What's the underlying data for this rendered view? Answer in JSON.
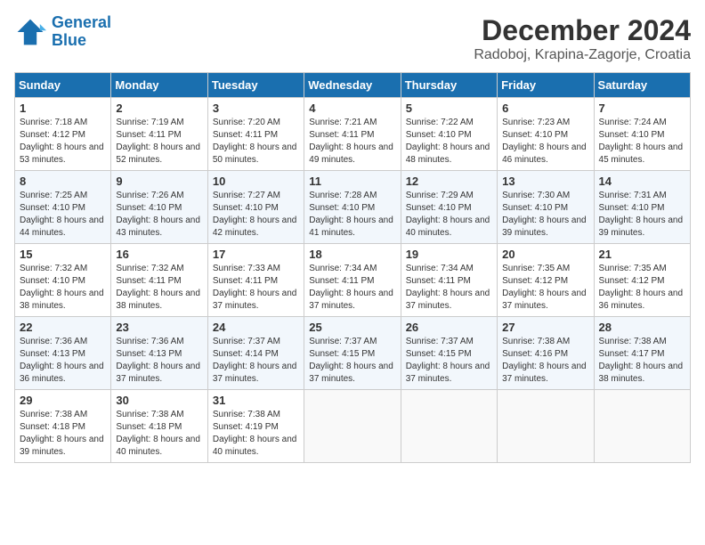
{
  "header": {
    "logo_line1": "General",
    "logo_line2": "Blue",
    "month": "December 2024",
    "location": "Radoboj, Krapina-Zagorje, Croatia"
  },
  "weekdays": [
    "Sunday",
    "Monday",
    "Tuesday",
    "Wednesday",
    "Thursday",
    "Friday",
    "Saturday"
  ],
  "weeks": [
    [
      {
        "day": "1",
        "sunrise": "Sunrise: 7:18 AM",
        "sunset": "Sunset: 4:12 PM",
        "daylight": "Daylight: 8 hours and 53 minutes."
      },
      {
        "day": "2",
        "sunrise": "Sunrise: 7:19 AM",
        "sunset": "Sunset: 4:11 PM",
        "daylight": "Daylight: 8 hours and 52 minutes."
      },
      {
        "day": "3",
        "sunrise": "Sunrise: 7:20 AM",
        "sunset": "Sunset: 4:11 PM",
        "daylight": "Daylight: 8 hours and 50 minutes."
      },
      {
        "day": "4",
        "sunrise": "Sunrise: 7:21 AM",
        "sunset": "Sunset: 4:11 PM",
        "daylight": "Daylight: 8 hours and 49 minutes."
      },
      {
        "day": "5",
        "sunrise": "Sunrise: 7:22 AM",
        "sunset": "Sunset: 4:10 PM",
        "daylight": "Daylight: 8 hours and 48 minutes."
      },
      {
        "day": "6",
        "sunrise": "Sunrise: 7:23 AM",
        "sunset": "Sunset: 4:10 PM",
        "daylight": "Daylight: 8 hours and 46 minutes."
      },
      {
        "day": "7",
        "sunrise": "Sunrise: 7:24 AM",
        "sunset": "Sunset: 4:10 PM",
        "daylight": "Daylight: 8 hours and 45 minutes."
      }
    ],
    [
      {
        "day": "8",
        "sunrise": "Sunrise: 7:25 AM",
        "sunset": "Sunset: 4:10 PM",
        "daylight": "Daylight: 8 hours and 44 minutes."
      },
      {
        "day": "9",
        "sunrise": "Sunrise: 7:26 AM",
        "sunset": "Sunset: 4:10 PM",
        "daylight": "Daylight: 8 hours and 43 minutes."
      },
      {
        "day": "10",
        "sunrise": "Sunrise: 7:27 AM",
        "sunset": "Sunset: 4:10 PM",
        "daylight": "Daylight: 8 hours and 42 minutes."
      },
      {
        "day": "11",
        "sunrise": "Sunrise: 7:28 AM",
        "sunset": "Sunset: 4:10 PM",
        "daylight": "Daylight: 8 hours and 41 minutes."
      },
      {
        "day": "12",
        "sunrise": "Sunrise: 7:29 AM",
        "sunset": "Sunset: 4:10 PM",
        "daylight": "Daylight: 8 hours and 40 minutes."
      },
      {
        "day": "13",
        "sunrise": "Sunrise: 7:30 AM",
        "sunset": "Sunset: 4:10 PM",
        "daylight": "Daylight: 8 hours and 39 minutes."
      },
      {
        "day": "14",
        "sunrise": "Sunrise: 7:31 AM",
        "sunset": "Sunset: 4:10 PM",
        "daylight": "Daylight: 8 hours and 39 minutes."
      }
    ],
    [
      {
        "day": "15",
        "sunrise": "Sunrise: 7:32 AM",
        "sunset": "Sunset: 4:10 PM",
        "daylight": "Daylight: 8 hours and 38 minutes."
      },
      {
        "day": "16",
        "sunrise": "Sunrise: 7:32 AM",
        "sunset": "Sunset: 4:11 PM",
        "daylight": "Daylight: 8 hours and 38 minutes."
      },
      {
        "day": "17",
        "sunrise": "Sunrise: 7:33 AM",
        "sunset": "Sunset: 4:11 PM",
        "daylight": "Daylight: 8 hours and 37 minutes."
      },
      {
        "day": "18",
        "sunrise": "Sunrise: 7:34 AM",
        "sunset": "Sunset: 4:11 PM",
        "daylight": "Daylight: 8 hours and 37 minutes."
      },
      {
        "day": "19",
        "sunrise": "Sunrise: 7:34 AM",
        "sunset": "Sunset: 4:11 PM",
        "daylight": "Daylight: 8 hours and 37 minutes."
      },
      {
        "day": "20",
        "sunrise": "Sunrise: 7:35 AM",
        "sunset": "Sunset: 4:12 PM",
        "daylight": "Daylight: 8 hours and 37 minutes."
      },
      {
        "day": "21",
        "sunrise": "Sunrise: 7:35 AM",
        "sunset": "Sunset: 4:12 PM",
        "daylight": "Daylight: 8 hours and 36 minutes."
      }
    ],
    [
      {
        "day": "22",
        "sunrise": "Sunrise: 7:36 AM",
        "sunset": "Sunset: 4:13 PM",
        "daylight": "Daylight: 8 hours and 36 minutes."
      },
      {
        "day": "23",
        "sunrise": "Sunrise: 7:36 AM",
        "sunset": "Sunset: 4:13 PM",
        "daylight": "Daylight: 8 hours and 37 minutes."
      },
      {
        "day": "24",
        "sunrise": "Sunrise: 7:37 AM",
        "sunset": "Sunset: 4:14 PM",
        "daylight": "Daylight: 8 hours and 37 minutes."
      },
      {
        "day": "25",
        "sunrise": "Sunrise: 7:37 AM",
        "sunset": "Sunset: 4:15 PM",
        "daylight": "Daylight: 8 hours and 37 minutes."
      },
      {
        "day": "26",
        "sunrise": "Sunrise: 7:37 AM",
        "sunset": "Sunset: 4:15 PM",
        "daylight": "Daylight: 8 hours and 37 minutes."
      },
      {
        "day": "27",
        "sunrise": "Sunrise: 7:38 AM",
        "sunset": "Sunset: 4:16 PM",
        "daylight": "Daylight: 8 hours and 37 minutes."
      },
      {
        "day": "28",
        "sunrise": "Sunrise: 7:38 AM",
        "sunset": "Sunset: 4:17 PM",
        "daylight": "Daylight: 8 hours and 38 minutes."
      }
    ],
    [
      {
        "day": "29",
        "sunrise": "Sunrise: 7:38 AM",
        "sunset": "Sunset: 4:18 PM",
        "daylight": "Daylight: 8 hours and 39 minutes."
      },
      {
        "day": "30",
        "sunrise": "Sunrise: 7:38 AM",
        "sunset": "Sunset: 4:18 PM",
        "daylight": "Daylight: 8 hours and 40 minutes."
      },
      {
        "day": "31",
        "sunrise": "Sunrise: 7:38 AM",
        "sunset": "Sunset: 4:19 PM",
        "daylight": "Daylight: 8 hours and 40 minutes."
      },
      null,
      null,
      null,
      null
    ]
  ]
}
